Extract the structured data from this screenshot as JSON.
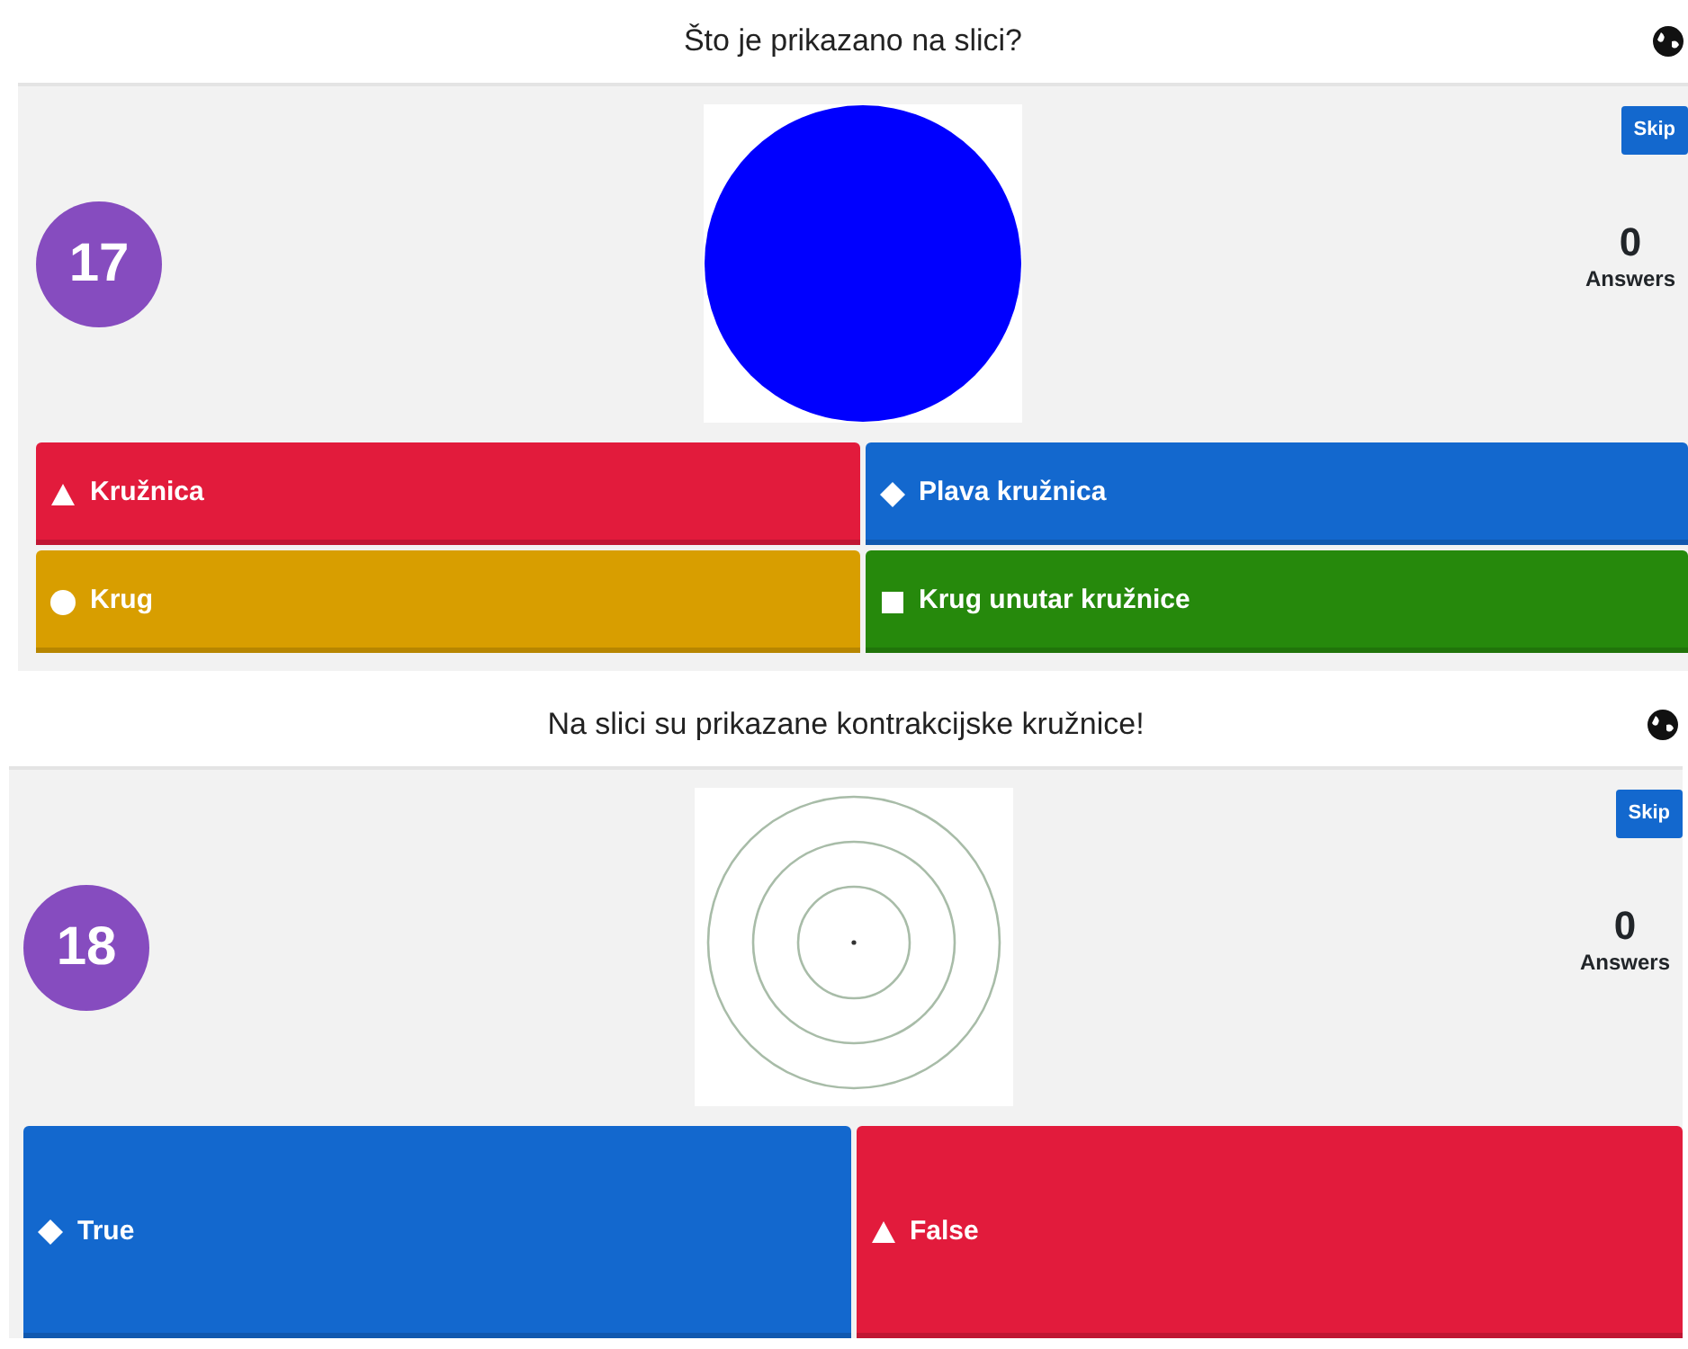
{
  "questions": [
    {
      "title": "Što je prikazano na slici?",
      "number": "17",
      "image": {
        "kind": "circle"
      },
      "skip": "Skip",
      "answer_count": "0",
      "answer_label": "Answers",
      "answers": [
        {
          "text": "Kružnica",
          "kind": "triangle",
          "color": "#e21b3c"
        },
        {
          "text": "Plava kružnica",
          "kind": "diamond",
          "color": "#1368ce"
        },
        {
          "text": "Krug",
          "kind": "circle",
          "color": "#d89e00"
        },
        {
          "text": "Krug unutar kružnice",
          "kind": "square",
          "color": "#26890c"
        }
      ]
    },
    {
      "title": "Na slici su prikazane kontrakcijske kružnice!",
      "number": "18",
      "image": {
        "kind": "concentric"
      },
      "skip": "Skip",
      "answer_count": "0",
      "answer_label": "Answers",
      "answers": [
        {
          "text": "True",
          "kind": "diamond",
          "color": "#1368ce"
        },
        {
          "text": "False",
          "kind": "triangle",
          "color": "#e21b3c"
        }
      ]
    }
  ]
}
